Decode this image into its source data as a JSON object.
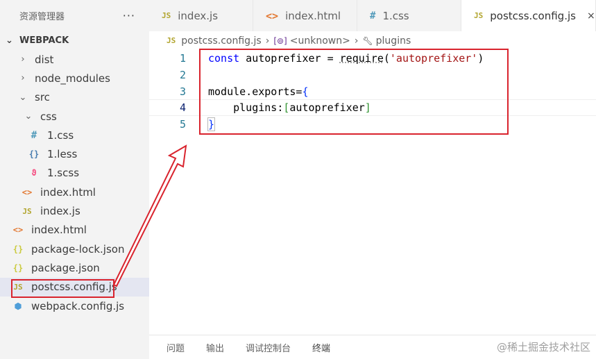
{
  "sidebar": {
    "title": "资源管理器",
    "more": "···",
    "section": "WEBPACK",
    "items": [
      {
        "label": "dist",
        "chevron": "›",
        "icon": ""
      },
      {
        "label": "node_modules",
        "chevron": "›",
        "icon": ""
      },
      {
        "label": "src",
        "chevron": "⌄",
        "icon": ""
      },
      {
        "label": "css",
        "chevron": "⌄",
        "icon": ""
      },
      {
        "label": "1.css",
        "icon": "#"
      },
      {
        "label": "1.less",
        "icon": "{}"
      },
      {
        "label": "1.scss",
        "icon": "ϑ"
      },
      {
        "label": "index.html",
        "icon": "<>"
      },
      {
        "label": "index.js",
        "icon": "JS"
      },
      {
        "label": "index.html",
        "icon": "<>"
      },
      {
        "label": "package-lock.json",
        "icon": "{}"
      },
      {
        "label": "package.json",
        "icon": "{}"
      },
      {
        "label": "postcss.config.js",
        "icon": "JS"
      },
      {
        "label": "webpack.config.js",
        "icon": "⬢"
      }
    ]
  },
  "tabs": [
    {
      "label": "index.js",
      "icon": "JS"
    },
    {
      "label": "index.html",
      "icon": "<>"
    },
    {
      "label": "1.css",
      "icon": "#"
    },
    {
      "label": "postcss.config.js",
      "icon": "JS",
      "close": "×"
    }
  ],
  "breadcrumb": {
    "file": "postcss.config.js",
    "scope": "<unknown>",
    "symbol": "plugins"
  },
  "editor": {
    "line_numbers": [
      "1",
      "2",
      "3",
      "4",
      "5"
    ],
    "lines": {
      "l1_kw": "const",
      "l1_a": " autoprefixer = ",
      "l1_req": "require",
      "l1_b": "(",
      "l1_str": "'autoprefixer'",
      "l1_c": ")",
      "l3_a": "module.exports=",
      "l3_b": "{",
      "l4_a": "    plugins:",
      "l4_b": "[",
      "l4_c": "autoprefixer",
      "l4_d": "]",
      "l5_a": "}"
    }
  },
  "panel": {
    "tabs": [
      "问题",
      "输出",
      "调试控制台",
      "终端"
    ]
  },
  "watermark": "@稀土掘金技术社区",
  "colors": {
    "sidebar_bg": "#f3f3f3",
    "selected_bg": "#e4e6f1",
    "annotation_red": "#d9232d",
    "keyword_blue": "#0000ff",
    "string_red": "#a31515"
  }
}
